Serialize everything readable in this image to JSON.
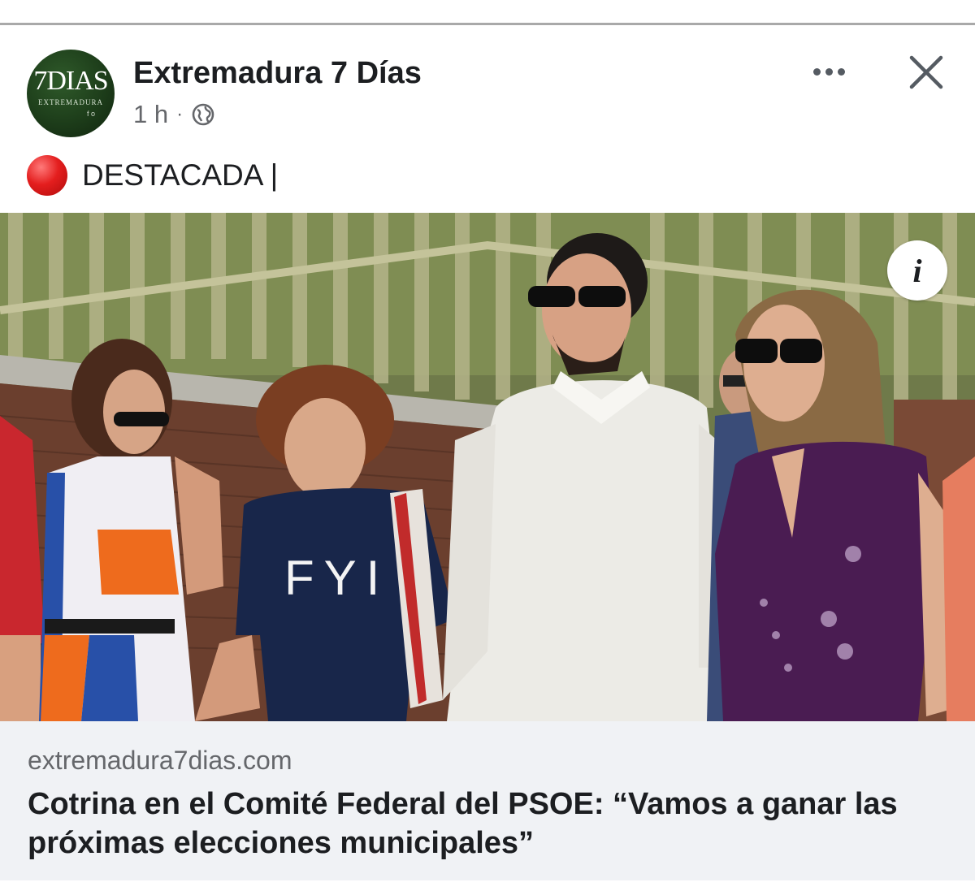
{
  "post": {
    "page_name": "Extremadura 7 Días",
    "time": "1 h",
    "separator": "·",
    "audience_icon": "globe-icon",
    "text": "DESTACADA |",
    "status_emoji": "red-circle-icon"
  },
  "avatar": {
    "logo_main": "7DIAS",
    "logo_sub": "EXTREMADURA",
    "logo_social": "f o"
  },
  "actions": {
    "more_icon": "more-horizontal-icon",
    "close_icon": "close-icon"
  },
  "photo": {
    "info_label": "i",
    "shirt_text": "FYI"
  },
  "link_preview": {
    "domain": "extremadura7dias.com",
    "title": "Cotrina en el Comité Federal del PSOE: “Vamos a ganar las próximas elecciones municipales”"
  },
  "colors": {
    "secondary_text": "#65676b",
    "link_box_bg": "#f0f2f5",
    "avatar_green": "#1d3d1a",
    "status_red": "#e41e1e"
  }
}
